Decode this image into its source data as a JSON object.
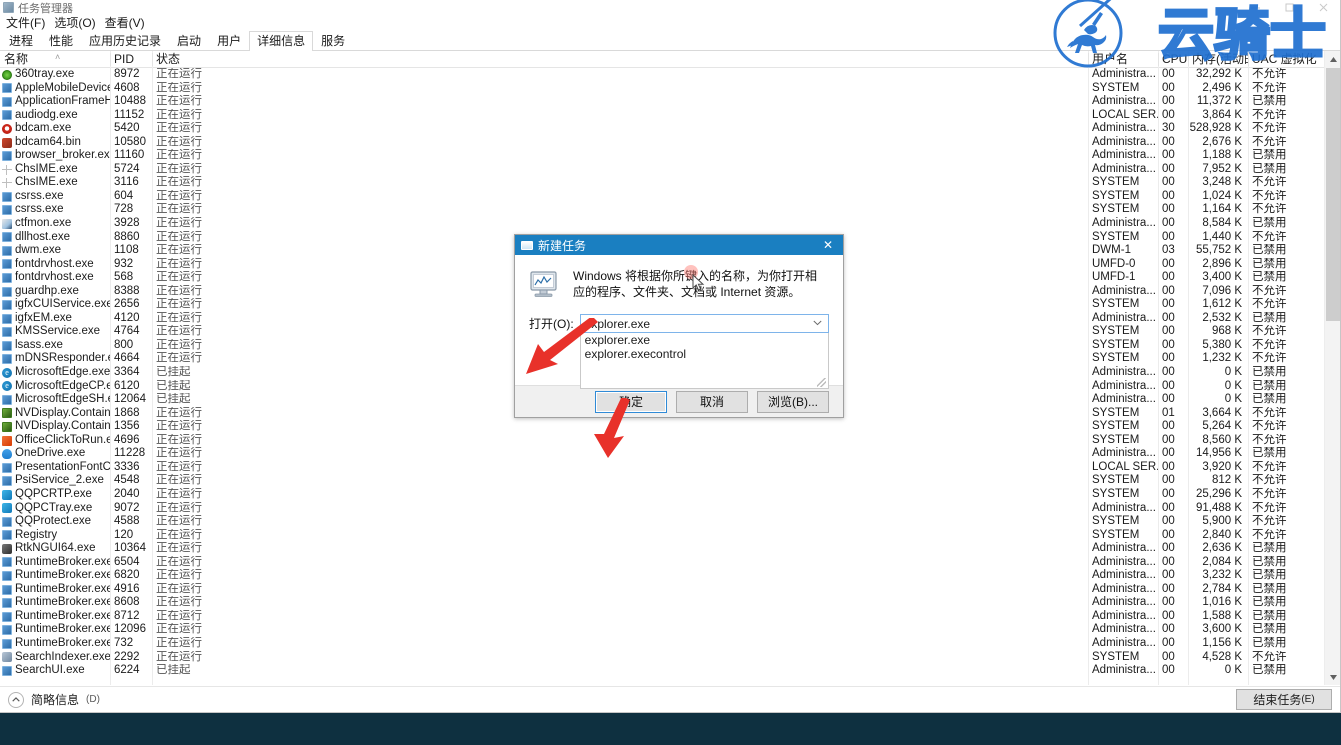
{
  "window": {
    "title": "任务管理器",
    "controls": {
      "minimize": "—",
      "maximize": "☐",
      "close": "✕"
    }
  },
  "menu": [
    {
      "label": "文件(F)"
    },
    {
      "label": "选项(O)"
    },
    {
      "label": "查看(V)"
    }
  ],
  "tabs": [
    {
      "label": "进程",
      "active": false
    },
    {
      "label": "性能",
      "active": false
    },
    {
      "label": "应用历史记录",
      "active": false
    },
    {
      "label": "启动",
      "active": false
    },
    {
      "label": "用户",
      "active": false
    },
    {
      "label": "详细信息",
      "active": true
    },
    {
      "label": "服务",
      "active": false
    }
  ],
  "table": {
    "columns": [
      {
        "key": "name",
        "label": "名称",
        "sorted": true,
        "sort_glyph": "˄"
      },
      {
        "key": "pid",
        "label": "PID"
      },
      {
        "key": "status",
        "label": "状态"
      },
      {
        "key": "user",
        "label": "用户名"
      },
      {
        "key": "cpu",
        "label": "CPU"
      },
      {
        "key": "mem",
        "label": "内存(活动的..."
      },
      {
        "key": "uac",
        "label": "UAC 虚拟化"
      }
    ],
    "rows": [
      {
        "icon": "app-360tray-icon",
        "name": "360tray.exe",
        "pid": "8972",
        "status": "正在运行",
        "user": "Administra...",
        "cpu": "00",
        "mem": "32,292 K",
        "uac": "不允许"
      },
      {
        "icon": "app-generic-icon",
        "name": "AppleMobileDevice...",
        "pid": "4608",
        "status": "正在运行",
        "user": "SYSTEM",
        "cpu": "00",
        "mem": "2,496 K",
        "uac": "不允许"
      },
      {
        "icon": "app-generic-icon",
        "name": "ApplicationFrameH...",
        "pid": "10488",
        "status": "正在运行",
        "user": "Administra...",
        "cpu": "00",
        "mem": "11,372 K",
        "uac": "已禁用"
      },
      {
        "icon": "app-generic-icon",
        "name": "audiodg.exe",
        "pid": "11152",
        "status": "正在运行",
        "user": "LOCAL SER...",
        "cpu": "00",
        "mem": "3,864 K",
        "uac": "不允许"
      },
      {
        "icon": "app-bdcam-icon",
        "name": "bdcam.exe",
        "pid": "5420",
        "status": "正在运行",
        "user": "Administra...",
        "cpu": "30",
        "mem": "528,928 K",
        "uac": "不允许"
      },
      {
        "icon": "app-bdcam64-icon",
        "name": "bdcam64.bin",
        "pid": "10580",
        "status": "正在运行",
        "user": "Administra...",
        "cpu": "00",
        "mem": "2,676 K",
        "uac": "不允许"
      },
      {
        "icon": "app-generic-icon",
        "name": "browser_broker.exe",
        "pid": "11160",
        "status": "正在运行",
        "user": "Administra...",
        "cpu": "00",
        "mem": "1,188 K",
        "uac": "已禁用"
      },
      {
        "icon": "app-ime-icon",
        "name": "ChsIME.exe",
        "pid": "5724",
        "status": "正在运行",
        "user": "Administra...",
        "cpu": "00",
        "mem": "7,952 K",
        "uac": "已禁用"
      },
      {
        "icon": "app-ime-icon",
        "name": "ChsIME.exe",
        "pid": "3116",
        "status": "正在运行",
        "user": "SYSTEM",
        "cpu": "00",
        "mem": "3,248 K",
        "uac": "不允许"
      },
      {
        "icon": "app-generic-icon",
        "name": "csrss.exe",
        "pid": "604",
        "status": "正在运行",
        "user": "SYSTEM",
        "cpu": "00",
        "mem": "1,024 K",
        "uac": "不允许"
      },
      {
        "icon": "app-generic-icon",
        "name": "csrss.exe",
        "pid": "728",
        "status": "正在运行",
        "user": "SYSTEM",
        "cpu": "00",
        "mem": "1,164 K",
        "uac": "不允许"
      },
      {
        "icon": "app-ctfmon-icon",
        "name": "ctfmon.exe",
        "pid": "3928",
        "status": "正在运行",
        "user": "Administra...",
        "cpu": "00",
        "mem": "8,584 K",
        "uac": "已禁用"
      },
      {
        "icon": "app-generic-icon",
        "name": "dllhost.exe",
        "pid": "8860",
        "status": "正在运行",
        "user": "SYSTEM",
        "cpu": "00",
        "mem": "1,440 K",
        "uac": "不允许"
      },
      {
        "icon": "app-generic-icon",
        "name": "dwm.exe",
        "pid": "1108",
        "status": "正在运行",
        "user": "DWM-1",
        "cpu": "03",
        "mem": "55,752 K",
        "uac": "已禁用"
      },
      {
        "icon": "app-generic-icon",
        "name": "fontdrvhost.exe",
        "pid": "932",
        "status": "正在运行",
        "user": "UMFD-0",
        "cpu": "00",
        "mem": "2,896 K",
        "uac": "已禁用"
      },
      {
        "icon": "app-generic-icon",
        "name": "fontdrvhost.exe",
        "pid": "568",
        "status": "正在运行",
        "user": "UMFD-1",
        "cpu": "00",
        "mem": "3,400 K",
        "uac": "已禁用"
      },
      {
        "icon": "app-generic-icon",
        "name": "guardhp.exe",
        "pid": "8388",
        "status": "正在运行",
        "user": "Administra...",
        "cpu": "00",
        "mem": "7,096 K",
        "uac": "不允许"
      },
      {
        "icon": "app-generic-icon",
        "name": "igfxCUIService.exe",
        "pid": "2656",
        "status": "正在运行",
        "user": "SYSTEM",
        "cpu": "00",
        "mem": "1,612 K",
        "uac": "不允许"
      },
      {
        "icon": "app-generic-icon",
        "name": "igfxEM.exe",
        "pid": "4120",
        "status": "正在运行",
        "user": "Administra...",
        "cpu": "00",
        "mem": "2,532 K",
        "uac": "已禁用"
      },
      {
        "icon": "app-generic-icon",
        "name": "KMSService.exe",
        "pid": "4764",
        "status": "正在运行",
        "user": "SYSTEM",
        "cpu": "00",
        "mem": "968 K",
        "uac": "不允许"
      },
      {
        "icon": "app-generic-icon",
        "name": "lsass.exe",
        "pid": "800",
        "status": "正在运行",
        "user": "SYSTEM",
        "cpu": "00",
        "mem": "5,380 K",
        "uac": "不允许"
      },
      {
        "icon": "app-generic-icon",
        "name": "mDNSResponder.exe",
        "pid": "4664",
        "status": "正在运行",
        "user": "SYSTEM",
        "cpu": "00",
        "mem": "1,232 K",
        "uac": "不允许"
      },
      {
        "icon": "app-edge-icon",
        "name": "MicrosoftEdge.exe",
        "pid": "3364",
        "status": "已挂起",
        "user": "Administra...",
        "cpu": "00",
        "mem": "0 K",
        "uac": "已禁用"
      },
      {
        "icon": "app-edge-icon",
        "name": "MicrosoftEdgeCP.exe",
        "pid": "6120",
        "status": "已挂起",
        "user": "Administra...",
        "cpu": "00",
        "mem": "0 K",
        "uac": "已禁用"
      },
      {
        "icon": "app-generic-icon",
        "name": "MicrosoftEdgeSH.exe",
        "pid": "12064",
        "status": "已挂起",
        "user": "Administra...",
        "cpu": "00",
        "mem": "0 K",
        "uac": "已禁用"
      },
      {
        "icon": "app-nvidia-icon",
        "name": "NVDisplay.Containe...",
        "pid": "1868",
        "status": "正在运行",
        "user": "SYSTEM",
        "cpu": "01",
        "mem": "3,664 K",
        "uac": "不允许"
      },
      {
        "icon": "app-nvidia-icon",
        "name": "NVDisplay.Containe...",
        "pid": "1356",
        "status": "正在运行",
        "user": "SYSTEM",
        "cpu": "00",
        "mem": "5,264 K",
        "uac": "不允许"
      },
      {
        "icon": "app-office-icon",
        "name": "OfficeClickToRun.exe",
        "pid": "4696",
        "status": "正在运行",
        "user": "SYSTEM",
        "cpu": "00",
        "mem": "8,560 K",
        "uac": "不允许"
      },
      {
        "icon": "app-onedrive-icon",
        "name": "OneDrive.exe",
        "pid": "11228",
        "status": "正在运行",
        "user": "Administra...",
        "cpu": "00",
        "mem": "14,956 K",
        "uac": "已禁用"
      },
      {
        "icon": "app-generic-icon",
        "name": "PresentationFontCa...",
        "pid": "3336",
        "status": "正在运行",
        "user": "LOCAL SER...",
        "cpu": "00",
        "mem": "3,920 K",
        "uac": "不允许"
      },
      {
        "icon": "app-generic-icon",
        "name": "PsiService_2.exe",
        "pid": "4548",
        "status": "正在运行",
        "user": "SYSTEM",
        "cpu": "00",
        "mem": "812 K",
        "uac": "不允许"
      },
      {
        "icon": "app-qq-icon",
        "name": "QQPCRTP.exe",
        "pid": "2040",
        "status": "正在运行",
        "user": "SYSTEM",
        "cpu": "00",
        "mem": "25,296 K",
        "uac": "不允许"
      },
      {
        "icon": "app-qq-icon",
        "name": "QQPCTray.exe",
        "pid": "9072",
        "status": "正在运行",
        "user": "Administra...",
        "cpu": "00",
        "mem": "91,488 K",
        "uac": "不允许"
      },
      {
        "icon": "app-generic-icon",
        "name": "QQProtect.exe",
        "pid": "4588",
        "status": "正在运行",
        "user": "SYSTEM",
        "cpu": "00",
        "mem": "5,900 K",
        "uac": "不允许"
      },
      {
        "icon": "app-generic-icon",
        "name": "Registry",
        "pid": "120",
        "status": "正在运行",
        "user": "SYSTEM",
        "cpu": "00",
        "mem": "2,840 K",
        "uac": "不允许"
      },
      {
        "icon": "app-realtek-icon",
        "name": "RtkNGUI64.exe",
        "pid": "10364",
        "status": "正在运行",
        "user": "Administra...",
        "cpu": "00",
        "mem": "2,636 K",
        "uac": "已禁用"
      },
      {
        "icon": "app-generic-icon",
        "name": "RuntimeBroker.exe",
        "pid": "6504",
        "status": "正在运行",
        "user": "Administra...",
        "cpu": "00",
        "mem": "2,084 K",
        "uac": "已禁用"
      },
      {
        "icon": "app-generic-icon",
        "name": "RuntimeBroker.exe",
        "pid": "6820",
        "status": "正在运行",
        "user": "Administra...",
        "cpu": "00",
        "mem": "3,232 K",
        "uac": "已禁用"
      },
      {
        "icon": "app-generic-icon",
        "name": "RuntimeBroker.exe",
        "pid": "4916",
        "status": "正在运行",
        "user": "Administra...",
        "cpu": "00",
        "mem": "2,784 K",
        "uac": "已禁用"
      },
      {
        "icon": "app-generic-icon",
        "name": "RuntimeBroker.exe",
        "pid": "8608",
        "status": "正在运行",
        "user": "Administra...",
        "cpu": "00",
        "mem": "1,016 K",
        "uac": "已禁用"
      },
      {
        "icon": "app-generic-icon",
        "name": "RuntimeBroker.exe",
        "pid": "8712",
        "status": "正在运行",
        "user": "Administra...",
        "cpu": "00",
        "mem": "1,588 K",
        "uac": "已禁用"
      },
      {
        "icon": "app-generic-icon",
        "name": "RuntimeBroker.exe",
        "pid": "12096",
        "status": "正在运行",
        "user": "Administra...",
        "cpu": "00",
        "mem": "3,600 K",
        "uac": "已禁用"
      },
      {
        "icon": "app-generic-icon",
        "name": "RuntimeBroker.exe",
        "pid": "732",
        "status": "正在运行",
        "user": "Administra...",
        "cpu": "00",
        "mem": "1,156 K",
        "uac": "已禁用"
      },
      {
        "icon": "app-searchindexer-icon",
        "name": "SearchIndexer.exe",
        "pid": "2292",
        "status": "正在运行",
        "user": "SYSTEM",
        "cpu": "00",
        "mem": "4,528 K",
        "uac": "不允许"
      },
      {
        "icon": "app-generic-icon",
        "name": "SearchUI.exe",
        "pid": "6224",
        "status": "已挂起",
        "user": "Administra...",
        "cpu": "00",
        "mem": "0 K",
        "uac": "已禁用"
      }
    ]
  },
  "footer": {
    "fewer_details": "简略信息",
    "fewer_details_accel": "(D)",
    "end_task": "结束任务",
    "end_task_accel": "(E)"
  },
  "dialog": {
    "title": "新建任务",
    "close_glyph": "✕",
    "description": "Windows 将根据你所键入的名称，为你打开相应的程序、文件夹、文档或 Internet 资源。",
    "open_label": "打开(O):",
    "input_value": "explorer.exe",
    "dropdown_options": [
      "explorer.exe",
      "explorer.execontrol"
    ],
    "buttons": {
      "ok": "确定",
      "cancel": "取消",
      "browse": "浏览(B)..."
    }
  },
  "watermark": {
    "text": "云骑士",
    "color": "#1f6fd0"
  },
  "colors": {
    "dialog_title_bar": "#1a7fc1",
    "accent_focus": "#2f8ad6",
    "desktop": "#0e3040",
    "annotation_arrow": "#e8312a"
  }
}
